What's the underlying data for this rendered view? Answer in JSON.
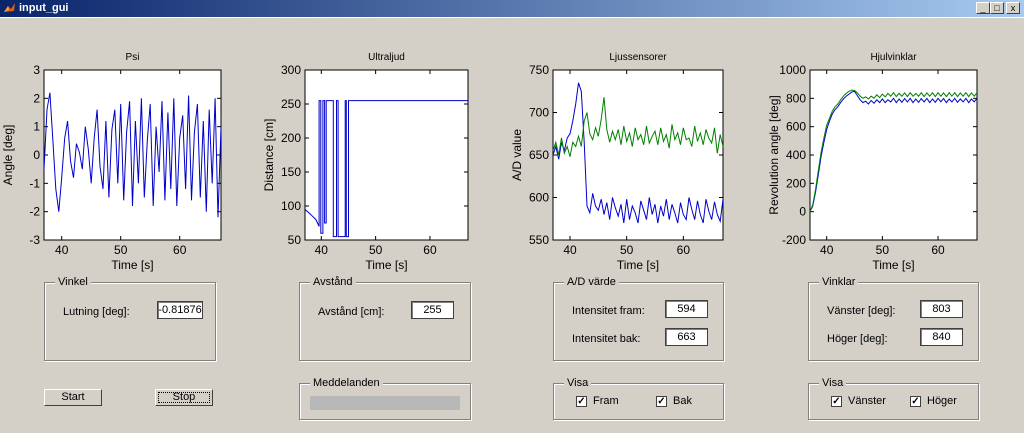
{
  "window": {
    "title": "input_gui",
    "min_glyph": "_",
    "max_glyph": "□",
    "close_glyph": "x"
  },
  "colors": {
    "blue": "#0000cc",
    "green": "#008000"
  },
  "plots": [
    {
      "title": "Psi",
      "xlabel": "Time [s]",
      "ylabel": "Angle [deg]",
      "xlim": [
        37,
        67
      ],
      "ylim": [
        -3,
        3
      ],
      "xticks": [
        "40",
        "50",
        "60"
      ],
      "xtick_vals": [
        40,
        50,
        60
      ],
      "yticks": [
        "-3",
        "-2",
        "-1",
        "0",
        "1",
        "2",
        "3"
      ],
      "ytick_vals": [
        -3,
        -2,
        -1,
        0,
        1,
        2,
        3
      ]
    },
    {
      "title": "Ultraljud",
      "xlabel": "Time [s]",
      "ylabel": "Distance [cm]",
      "xlim": [
        37,
        67
      ],
      "ylim": [
        50,
        300
      ],
      "xticks": [
        "40",
        "50",
        "60"
      ],
      "xtick_vals": [
        40,
        50,
        60
      ],
      "yticks": [
        "50",
        "100",
        "150",
        "200",
        "250",
        "300"
      ],
      "ytick_vals": [
        50,
        100,
        150,
        200,
        250,
        300
      ]
    },
    {
      "title": "Ljussensorer",
      "xlabel": "Time [s]",
      "ylabel": "A/D value",
      "xlim": [
        37,
        67
      ],
      "ylim": [
        550,
        750
      ],
      "xticks": [
        "40",
        "50",
        "60"
      ],
      "xtick_vals": [
        40,
        50,
        60
      ],
      "yticks": [
        "550",
        "600",
        "650",
        "700",
        "750"
      ],
      "ytick_vals": [
        550,
        600,
        650,
        700,
        750
      ]
    },
    {
      "title": "Hjulvinklar",
      "xlabel": "Time [s]",
      "ylabel": "Revolution angle [deg]",
      "xlim": [
        37,
        67
      ],
      "ylim": [
        -200,
        1000
      ],
      "xticks": [
        "40",
        "50",
        "60"
      ],
      "xtick_vals": [
        40,
        50,
        60
      ],
      "yticks": [
        "-200",
        "0",
        "200",
        "400",
        "600",
        "800",
        "1000"
      ],
      "ytick_vals": [
        -200,
        0,
        200,
        400,
        600,
        800,
        1000
      ]
    }
  ],
  "chart_data": [
    {
      "type": "line",
      "title": "Psi",
      "xlabel": "Time [s]",
      "ylabel": "Angle [deg]",
      "xlim": [
        37,
        67
      ],
      "ylim": [
        -3,
        3
      ],
      "series": [
        {
          "color": "#0000cc",
          "x": [
            37,
            37.5,
            38,
            38.5,
            39,
            39.5,
            40,
            40.5,
            41,
            41.5,
            42,
            42.5,
            43,
            43.5,
            44,
            44.5,
            45,
            45.5,
            46,
            46.5,
            47,
            47.5,
            48,
            48.5,
            49,
            49.5,
            50,
            50.5,
            51,
            51.5,
            52,
            52.5,
            53,
            53.5,
            54,
            54.5,
            55,
            55.5,
            56,
            56.5,
            57,
            57.5,
            58,
            58.5,
            59,
            59.5,
            60,
            60.5,
            61,
            61.5,
            62,
            62.5,
            63,
            63.5,
            64,
            64.5,
            65,
            65.5,
            66,
            66.5,
            67
          ],
          "y": [
            -0.5,
            1.6,
            2.2,
            0.5,
            -1.2,
            -2.0,
            -0.8,
            0.6,
            1.2,
            -0.2,
            -0.8,
            0.4,
            0.1,
            -0.5,
            1.0,
            0.2,
            -1.0,
            0.6,
            1.6,
            -0.4,
            -1.2,
            1.2,
            -1.5,
            0.9,
            1.6,
            -1.0,
            1.8,
            -1.6,
            0.8,
            1.9,
            -1.8,
            1.2,
            -1.0,
            2.0,
            -1.5,
            0.5,
            1.8,
            -1.8,
            1.0,
            -0.6,
            1.9,
            -1.6,
            1.5,
            -1.2,
            2.0,
            -1.8,
            0.6,
            1.4,
            -1.2,
            2.1,
            -1.6,
            0.8,
            1.8,
            -1.5,
            1.2,
            -2.0,
            1.6,
            -1.0,
            2.0,
            -2.2,
            1.0
          ]
        }
      ]
    },
    {
      "type": "line",
      "title": "Ultraljud",
      "xlabel": "Time [s]",
      "ylabel": "Distance [cm]",
      "xlim": [
        37,
        67
      ],
      "ylim": [
        50,
        300
      ],
      "series": [
        {
          "color": "#0000cc",
          "x": [
            37,
            38,
            39,
            39.6,
            39.6,
            39.9,
            39.9,
            40.3,
            40.3,
            40.6,
            40.6,
            40.9,
            40.9,
            42.2,
            42.2,
            42.8,
            42.8,
            43.1,
            43.1,
            44.4,
            44.4,
            44.6,
            44.6,
            45.0,
            45.0,
            45.3,
            45.3,
            67
          ],
          "y": [
            95,
            88,
            80,
            70,
            255,
            255,
            60,
            60,
            255,
            255,
            75,
            75,
            255,
            255,
            55,
            55,
            255,
            255,
            55,
            55,
            255,
            255,
            55,
            55,
            255,
            255,
            255,
            255
          ]
        }
      ]
    },
    {
      "type": "line",
      "title": "Ljussensorer",
      "xlabel": "Time [s]",
      "ylabel": "A/D value",
      "xlim": [
        37,
        67
      ],
      "ylim": [
        550,
        750
      ],
      "series": [
        {
          "color": "#0000cc",
          "x": [
            37,
            37.5,
            38,
            38.5,
            39,
            39.5,
            40,
            40.5,
            41,
            41.5,
            42,
            42.5,
            43,
            43.5,
            44,
            44.5,
            45,
            45.5,
            46,
            46.5,
            47,
            47.5,
            48,
            48.5,
            49,
            49.5,
            50,
            50.5,
            51,
            51.5,
            52,
            52.5,
            53,
            53.5,
            54,
            54.5,
            55,
            55.5,
            56,
            56.5,
            57,
            57.5,
            58,
            58.5,
            59,
            59.5,
            60,
            60.5,
            61,
            61.5,
            62,
            62.5,
            63,
            63.5,
            64,
            64.5,
            65,
            65.5,
            66,
            66.5,
            67
          ],
          "y": [
            650,
            660,
            645,
            665,
            655,
            670,
            675,
            690,
            710,
            735,
            725,
            665,
            590,
            582,
            605,
            590,
            585,
            598,
            580,
            594,
            574,
            600,
            588,
            578,
            592,
            570,
            598,
            574,
            590,
            582,
            570,
            596,
            585,
            574,
            600,
            580,
            592,
            570,
            590,
            578,
            598,
            574,
            592,
            582,
            570,
            594,
            580,
            574,
            600,
            586,
            574,
            596,
            580,
            570,
            598,
            584,
            574,
            595,
            580,
            572,
            598
          ]
        },
        {
          "color": "#008000",
          "x": [
            37,
            37.5,
            38,
            38.5,
            39,
            39.5,
            40,
            40.5,
            41,
            41.5,
            42,
            42.5,
            43,
            43.5,
            44,
            44.5,
            45,
            45.5,
            46,
            46.5,
            47,
            47.5,
            48,
            48.5,
            49,
            49.5,
            50,
            50.5,
            51,
            51.5,
            52,
            52.5,
            53,
            53.5,
            54,
            54.5,
            55,
            55.5,
            56,
            56.5,
            57,
            57.5,
            58,
            58.5,
            59,
            59.5,
            60,
            60.5,
            61,
            61.5,
            62,
            62.5,
            63,
            63.5,
            64,
            64.5,
            65,
            65.5,
            66,
            66.5,
            67
          ],
          "y": [
            655,
            665,
            650,
            670,
            652,
            660,
            648,
            665,
            660,
            672,
            660,
            690,
            700,
            675,
            668,
            682,
            672,
            692,
            718,
            680,
            665,
            678,
            668,
            680,
            662,
            684,
            666,
            676,
            660,
            682,
            668,
            674,
            662,
            684,
            664,
            672,
            678,
            662,
            682,
            666,
            674,
            658,
            686,
            668,
            676,
            662,
            682,
            668,
            670,
            660,
            684,
            666,
            676,
            662,
            680,
            670,
            664,
            682,
            652,
            674,
            660
          ]
        }
      ]
    },
    {
      "type": "line",
      "title": "Hjulvinklar",
      "xlabel": "Time [s]",
      "ylabel": "Revolution angle [deg]",
      "xlim": [
        37,
        67
      ],
      "ylim": [
        -200,
        1000
      ],
      "series": [
        {
          "color": "#0000cc",
          "x": [
            37,
            37.5,
            38,
            38.5,
            39,
            39.5,
            40,
            40.5,
            41,
            41.5,
            42,
            42.5,
            43,
            43.5,
            44,
            44.5,
            45,
            45.5,
            46,
            46.5,
            47,
            47.5,
            48,
            48.5,
            49,
            49.5,
            50,
            50.5,
            51,
            51.5,
            52,
            52.5,
            53,
            53.5,
            54,
            54.5,
            55,
            55.5,
            56,
            56.5,
            57,
            57.5,
            58,
            58.5,
            59,
            59.5,
            60,
            60.5,
            61,
            61.5,
            62,
            62.5,
            63,
            63.5,
            64,
            64.5,
            65,
            65.5,
            66,
            66.5,
            67
          ],
          "y": [
            0,
            40,
            140,
            260,
            390,
            490,
            580,
            640,
            690,
            720,
            740,
            770,
            795,
            815,
            830,
            845,
            850,
            820,
            790,
            770,
            780,
            760,
            785,
            765,
            790,
            770,
            795,
            770,
            790,
            775,
            800,
            770,
            795,
            772,
            798,
            775,
            800,
            770,
            795,
            772,
            798,
            775,
            800,
            770,
            795,
            772,
            800,
            776,
            798,
            770,
            795,
            774,
            800,
            772,
            796,
            775,
            800,
            770,
            795,
            775,
            800
          ]
        },
        {
          "color": "#008000",
          "x": [
            37,
            37.5,
            38,
            38.5,
            39,
            39.5,
            40,
            40.5,
            41,
            41.5,
            42,
            42.5,
            43,
            43.5,
            44,
            44.5,
            45,
            45.5,
            46,
            46.5,
            47,
            47.5,
            48,
            48.5,
            49,
            49.5,
            50,
            50.5,
            51,
            51.5,
            52,
            52.5,
            53,
            53.5,
            54,
            54.5,
            55,
            55.5,
            56,
            56.5,
            57,
            57.5,
            58,
            58.5,
            59,
            59.5,
            60,
            60.5,
            61,
            61.5,
            62,
            62.5,
            63,
            63.5,
            64,
            64.5,
            65,
            65.5,
            66,
            66.5,
            67
          ],
          "y": [
            0,
            50,
            160,
            290,
            420,
            520,
            610,
            660,
            710,
            740,
            760,
            790,
            815,
            835,
            850,
            858,
            855,
            840,
            815,
            800,
            810,
            795,
            815,
            800,
            825,
            805,
            830,
            810,
            835,
            815,
            840,
            812,
            835,
            815,
            838,
            812,
            840,
            815,
            835,
            815,
            840,
            812,
            838,
            815,
            840,
            812,
            840,
            815,
            838,
            812,
            840,
            815,
            840,
            812,
            838,
            815,
            840,
            812,
            838,
            815,
            840
          ]
        }
      ]
    }
  ],
  "panels": {
    "vinkel": {
      "title": "Vinkel",
      "label": "Lutning [deg]:",
      "value": "-0.81876"
    },
    "avstand": {
      "title": "Avstånd",
      "label": "Avstånd [cm]:",
      "value": "255"
    },
    "ad": {
      "title": "A/D värde",
      "fram_label": "Intensitet fram:",
      "fram_value": "594",
      "bak_label": "Intensitet bak:",
      "bak_value": "663"
    },
    "vinklar": {
      "title": "Vinklar",
      "vanster_label": "Vänster [deg]:",
      "vanster_value": "803",
      "hoger_label": "Höger [deg]:",
      "hoger_value": "840"
    },
    "meddelanden": {
      "title": "Meddelanden"
    },
    "visa_ljus": {
      "title": "Visa",
      "fram_label": "Fram",
      "fram_checked": true,
      "bak_label": "Bak",
      "bak_checked": true
    },
    "visa_hjul": {
      "title": "Visa",
      "vanster_label": "Vänster",
      "vanster_checked": true,
      "hoger_label": "Höger",
      "hoger_checked": true
    }
  },
  "buttons": {
    "start": "Start",
    "stop": "Stop"
  },
  "check_glyph": "✓"
}
